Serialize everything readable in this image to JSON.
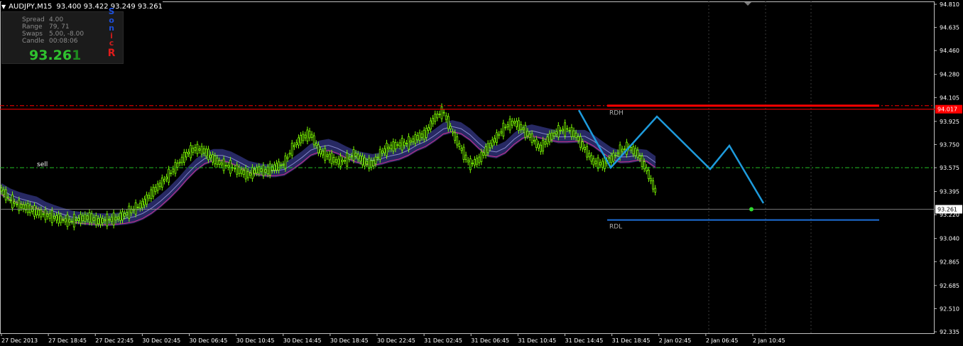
{
  "header": {
    "symbol": "AUDJPY,M15",
    "ohlc": "93.400 93.422 93.249 93.261"
  },
  "infobox": {
    "rows": [
      {
        "label": "Spread",
        "value": "4.00"
      },
      {
        "label": "Range",
        "value": "79, 71"
      },
      {
        "label": "Swaps",
        "value": "5.00, -8.00"
      },
      {
        "label": "Candle",
        "value": "00:08:06"
      }
    ],
    "price_main": "93.26",
    "price_last": "1",
    "sonic_letters": [
      "S",
      "o",
      "n",
      "i",
      "c",
      "R"
    ]
  },
  "levels": {
    "rdh_label": "RDH",
    "rdl_label": "RDL",
    "sell_label": "sell",
    "rdh_price_tag": "94.017",
    "current_price_tag": "93.261"
  },
  "colors": {
    "background": "#000000",
    "candle": "#7CFC00",
    "ma_band": "#2b2d6e",
    "ma_pink": "#d0308e",
    "rdh_line": "#ff0000",
    "rdl_line": "#1e6fd9",
    "zigzag": "#1e9bdc",
    "sell_line": "#22c022",
    "grid_vertical": "#3a3a3a"
  },
  "chart_data": {
    "type": "line",
    "title": "AUDJPY,M15",
    "y_ticks": [
      "94.810",
      "94.635",
      "94.460",
      "94.280",
      "94.105",
      "93.925",
      "93.750",
      "93.575",
      "93.395",
      "93.220",
      "93.040",
      "92.865",
      "92.685",
      "92.510",
      "92.335"
    ],
    "x_ticks": [
      "27 Dec 2013",
      "27 Dec 18:45",
      "27 Dec 22:45",
      "30 Dec 02:45",
      "30 Dec 06:45",
      "30 Dec 10:45",
      "30 Dec 14:45",
      "30 Dec 18:45",
      "30 Dec 22:45",
      "31 Dec 02:45",
      "31 Dec 06:45",
      "31 Dec 10:45",
      "31 Dec 14:45",
      "31 Dec 18:45",
      "2 Jan 02:45",
      "2 Jan 06:45",
      "2 Jan 10:45"
    ],
    "ylim": [
      92.335,
      94.81
    ],
    "series": [
      {
        "name": "",
        "x_index": [
          0,
          4,
          8,
          12,
          16,
          20,
          24,
          28,
          32,
          36,
          40,
          44,
          48,
          52,
          56,
          60,
          64,
          68,
          72,
          76,
          80,
          84,
          88,
          92,
          96,
          100,
          104,
          108,
          112,
          116,
          120,
          124,
          128,
          132,
          136,
          140,
          144,
          148,
          152,
          156,
          160,
          164,
          168,
          172,
          176,
          180,
          184,
          188,
          192,
          196,
          200,
          204,
          208,
          212,
          216,
          220,
          224,
          228,
          232,
          236,
          240,
          244,
          248,
          252,
          256,
          260,
          264,
          268,
          272,
          276,
          280,
          284,
          288,
          292,
          296,
          300,
          304,
          308,
          312,
          316,
          320,
          324,
          328,
          332,
          336,
          340
        ],
        "values": [
          93.41,
          93.33,
          93.29,
          93.27,
          93.24,
          93.22,
          93.2,
          93.18,
          93.17,
          93.19,
          93.2,
          93.17,
          93.18,
          93.19,
          93.22,
          93.26,
          93.3,
          93.38,
          93.45,
          93.52,
          93.6,
          93.68,
          93.72,
          93.7,
          93.64,
          93.6,
          93.58,
          93.55,
          93.52,
          93.56,
          93.55,
          93.58,
          93.6,
          93.73,
          93.8,
          93.83,
          93.7,
          93.66,
          93.62,
          93.63,
          93.68,
          93.62,
          93.6,
          93.69,
          93.73,
          93.75,
          93.76,
          93.8,
          93.83,
          93.95,
          94.0,
          93.85,
          93.72,
          93.6,
          93.63,
          93.72,
          93.8,
          93.88,
          93.92,
          93.87,
          93.8,
          93.72,
          93.8,
          93.85,
          93.87,
          93.82,
          93.72,
          93.62,
          93.6,
          93.64,
          93.7,
          93.73,
          93.68,
          93.56,
          93.4,
          93.26,
          93.26,
          93.26,
          93.26,
          93.26,
          93.26,
          93.26,
          93.26,
          93.26,
          93.26,
          93.26
        ]
      }
    ]
  }
}
